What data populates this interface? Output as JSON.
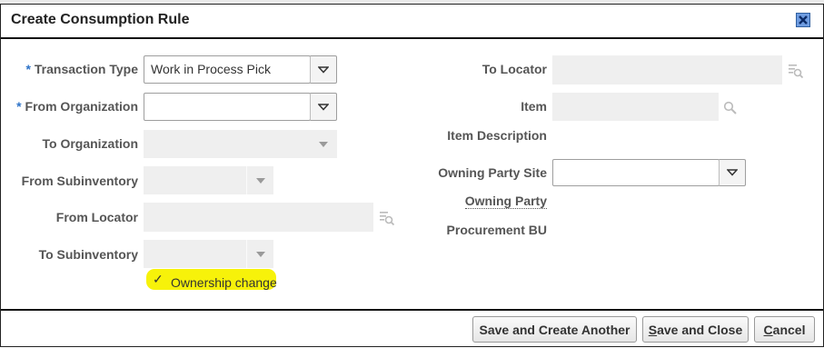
{
  "dialog": {
    "title": "Create Consumption Rule"
  },
  "left": {
    "transaction_type": {
      "required": "*",
      "label": "Transaction Type",
      "value": "Work in Process Pick"
    },
    "from_organization": {
      "required": "*",
      "label": "From Organization",
      "value": ""
    },
    "to_organization": {
      "label": "To Organization"
    },
    "from_subinventory": {
      "label": "From Subinventory"
    },
    "from_locator": {
      "label": "From Locator"
    },
    "to_subinventory": {
      "label": "To Subinventory"
    },
    "ownership_change": {
      "label": "Ownership change",
      "checked": true
    }
  },
  "right": {
    "to_locator": {
      "label": "To Locator"
    },
    "item": {
      "label": "Item"
    },
    "item_description": {
      "label": "Item Description"
    },
    "owning_party_site": {
      "label": "Owning Party Site"
    },
    "owning_party": {
      "label": "Owning Party"
    },
    "procurement_bu": {
      "label": "Procurement BU"
    }
  },
  "footer": {
    "save_create_another": "Save and Create Another",
    "save_close_prefix": "S",
    "save_close_rest": "ave and Close",
    "cancel_prefix": "C",
    "cancel_rest": "ancel"
  },
  "colors": {
    "required_star": "#2e73c8",
    "highlight": "#f7f20a",
    "disabled_field": "#efefef"
  }
}
